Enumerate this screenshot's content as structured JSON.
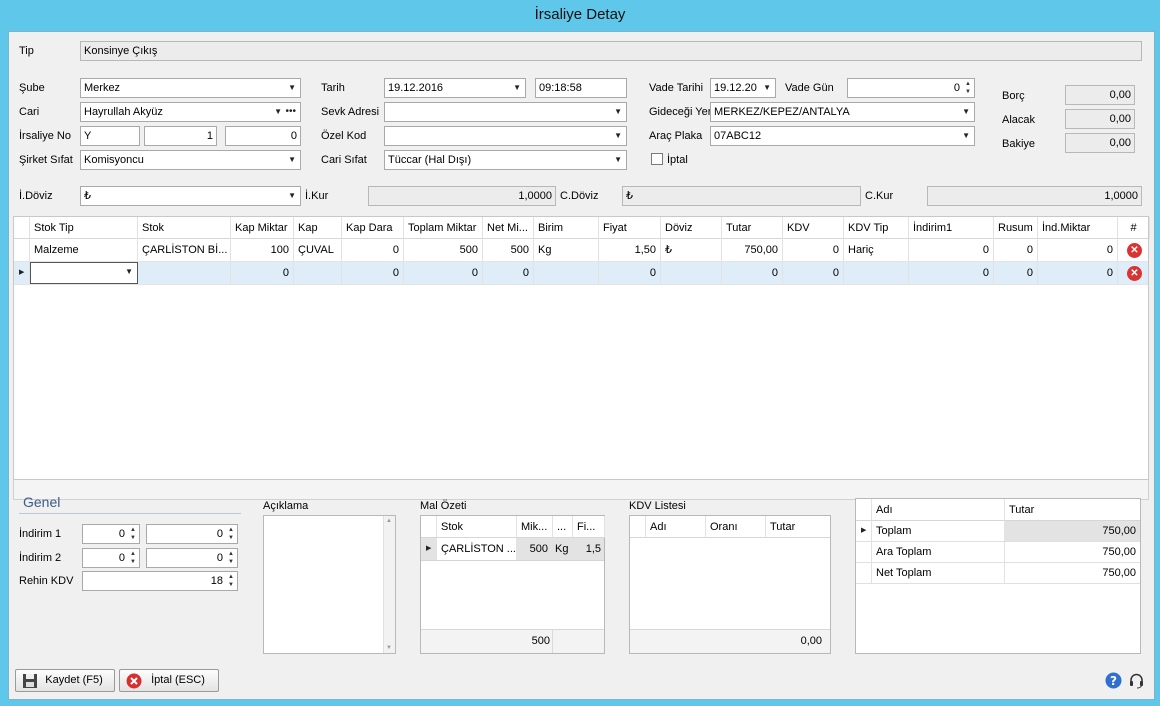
{
  "window": {
    "title": "İrsaliye Detay"
  },
  "tip": {
    "label": "Tip",
    "value": "Konsinye Çıkış"
  },
  "left": {
    "sube_label": "Şube",
    "sube_value": "Merkez",
    "cari_label": "Cari",
    "cari_value": "Hayrullah Akyüz",
    "irsaliye_label": "İrsaliye No",
    "irsaliye_seri": "Y",
    "irsaliye_no1": "1",
    "irsaliye_no2": "0",
    "sirket_label": "Şirket Sıfat",
    "sirket_value": "Komisyoncu"
  },
  "mid": {
    "tarih_label": "Tarih",
    "tarih_value": "19.12.2016",
    "saat_value": "09:18:58",
    "sevk_label": "Sevk Adresi",
    "sevk_value": "",
    "ozel_label": "Özel Kod",
    "ozel_value": "",
    "cari_sifat_label": "Cari Sıfat",
    "cari_sifat_value": "Tüccar (Hal Dışı)"
  },
  "right": {
    "vade_tarihi_label": "Vade Tarihi",
    "vade_tarihi_value": "19.12.20",
    "vade_gun_label": "Vade Gün",
    "vade_gun_value": "0",
    "gidecegi_label": "Gideceği Yer",
    "gidecegi_value": "MERKEZ/KEPEZ/ANTALYA",
    "plaka_label": "Araç Plaka",
    "plaka_value": "07ABC12",
    "iptal_label": "İptal"
  },
  "balance": {
    "borc_label": "Borç",
    "borc_value": "0,00",
    "alacak_label": "Alacak",
    "alacak_value": "0,00",
    "bakiye_label": "Bakiye",
    "bakiye_value": "0,00"
  },
  "currency": {
    "idoviz_label": "İ.Döviz",
    "idoviz_value": "₺",
    "ikur_label": "İ.Kur",
    "ikur_value": "1,0000",
    "cdoviz_label": "C.Döviz",
    "cdoviz_value": "₺",
    "ckur_label": "C.Kur",
    "ckur_value": "1,0000"
  },
  "grid": {
    "headers": [
      "Stok Tip",
      "Stok",
      "Kap Miktar",
      "Kap",
      "Kap Dara",
      "Toplam Miktar",
      "Net Mi...",
      "Birim",
      "Fiyat",
      "Döviz",
      "Tutar",
      "KDV",
      "KDV Tip",
      "İndirim1",
      "Rusum",
      "İnd.Miktar",
      "#"
    ],
    "rows": [
      [
        "Malzeme",
        "ÇARLİSTON Bİ...",
        "100",
        "ÇUVAL",
        "0",
        "500",
        "500",
        "Kg",
        "1,50",
        "₺",
        "750,00",
        "0",
        "Hariç",
        "0",
        "0",
        "0"
      ],
      [
        "",
        "",
        "0",
        "",
        "0",
        "0",
        "0",
        "",
        "0",
        "",
        "0",
        "0",
        "",
        "0",
        "0",
        "0"
      ]
    ]
  },
  "genel": {
    "title": "Genel",
    "indirim1_label": "İndirim 1",
    "indirim1_a": "0",
    "indirim1_b": "0",
    "indirim2_label": "İndirim 2",
    "indirim2_a": "0",
    "indirim2_b": "0",
    "rehin_label": "Rehin KDV",
    "rehin_value": "18"
  },
  "aciklama": {
    "label": "Açıklama",
    "value": ""
  },
  "mal_ozeti": {
    "label": "Mal Özeti",
    "headers": [
      "Stok",
      "Mik...",
      "...",
      "Fi..."
    ],
    "row": [
      "ÇARLİSTON ...",
      "500",
      "Kg",
      "1,5"
    ],
    "footer": "500"
  },
  "kdv_listesi": {
    "label": "KDV Listesi",
    "headers": [
      "Adı",
      "Oranı",
      "Tutar"
    ],
    "footer": "0,00"
  },
  "summary": {
    "headers": [
      "Adı",
      "Tutar"
    ],
    "rows": [
      [
        "Toplam",
        "750,00"
      ],
      [
        "Ara Toplam",
        "750,00"
      ],
      [
        "Net Toplam",
        "750,00"
      ]
    ]
  },
  "buttons": {
    "save": "Kaydet (F5)",
    "cancel": "İptal (ESC)"
  }
}
